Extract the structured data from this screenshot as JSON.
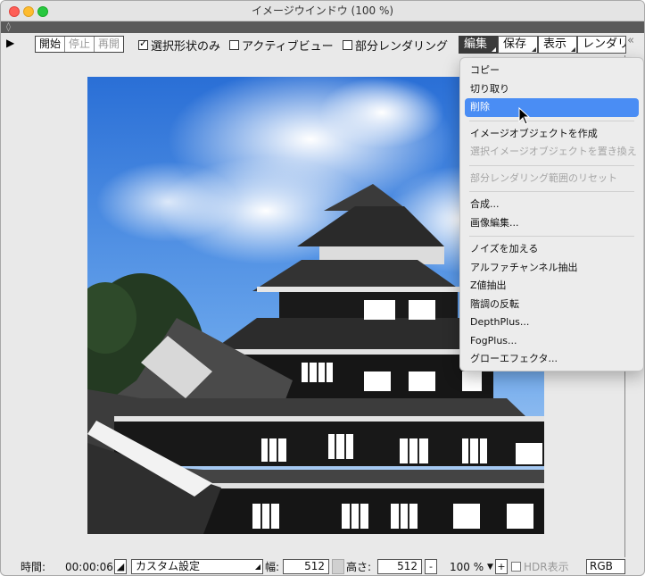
{
  "window": {
    "title": "イメージウインドウ (100 %)"
  },
  "toolbar": {
    "buttons": [
      "開始",
      "停止",
      "再開"
    ],
    "checkboxes": [
      {
        "label": "選択形状のみ",
        "checked": true
      },
      {
        "label": "アクティブビュー",
        "checked": false
      },
      {
        "label": "部分レンダリング",
        "checked": false
      }
    ],
    "menus": [
      "編集",
      "保存",
      "表示",
      "レンダリ"
    ],
    "collapse": "«"
  },
  "menu": {
    "items": [
      {
        "label": "コピー",
        "state": "normal"
      },
      {
        "label": "切り取り",
        "state": "normal"
      },
      {
        "label": "削除",
        "state": "highlight"
      },
      {
        "label": "イメージオブジェクトを作成",
        "state": "normal"
      },
      {
        "label": "選択イメージオブジェクトを置き換え",
        "state": "disabled"
      },
      {
        "label": "部分レンダリング範囲のリセット",
        "state": "disabled"
      },
      {
        "label": "合成...",
        "state": "normal"
      },
      {
        "label": "画像編集...",
        "state": "normal"
      },
      {
        "label": "ノイズを加える",
        "state": "normal"
      },
      {
        "label": "アルファチャンネル抽出",
        "state": "normal"
      },
      {
        "label": "Z値抽出",
        "state": "normal"
      },
      {
        "label": "階調の反転",
        "state": "normal"
      },
      {
        "label": "DepthPlus...",
        "state": "normal"
      },
      {
        "label": "FogPlus...",
        "state": "normal"
      },
      {
        "label": "グローエフェクタ...",
        "state": "normal"
      }
    ]
  },
  "status": {
    "time_label": "時間:",
    "time_value": "00:00:06",
    "preset": "カスタム設定",
    "width_label": "幅:",
    "width_value": "512",
    "height_label": "高さ:",
    "height_value": "512",
    "minus": "-",
    "zoom": "100 %",
    "plus": "+",
    "hdr_label": "HDR表示",
    "color_mode": "RGB"
  },
  "colors": {
    "highlight": "#4a8df4",
    "active_menu": "#3b3b3b"
  }
}
